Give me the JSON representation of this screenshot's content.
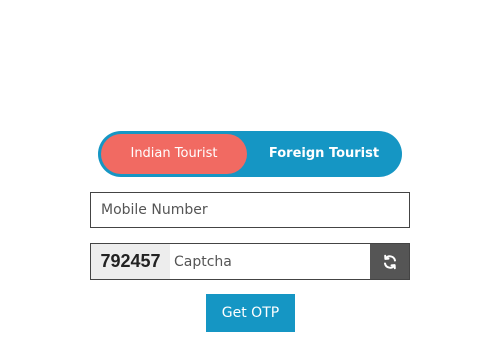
{
  "tourist_toggle": {
    "indian_label": "Indian Tourist",
    "foreign_label": "Foreign Tourist",
    "selected": "Indian Tourist"
  },
  "mobile": {
    "placeholder": "Mobile Number",
    "value": ""
  },
  "captcha": {
    "code": "792457",
    "placeholder": "Captcha",
    "value": "",
    "refresh_icon": "refresh-icon"
  },
  "submit": {
    "label": "Get OTP"
  },
  "colors": {
    "toggle_bg": "#1596c4",
    "toggle_active": "#f16a62",
    "refresh_bg": "#555555",
    "button_bg": "#1596c4"
  }
}
